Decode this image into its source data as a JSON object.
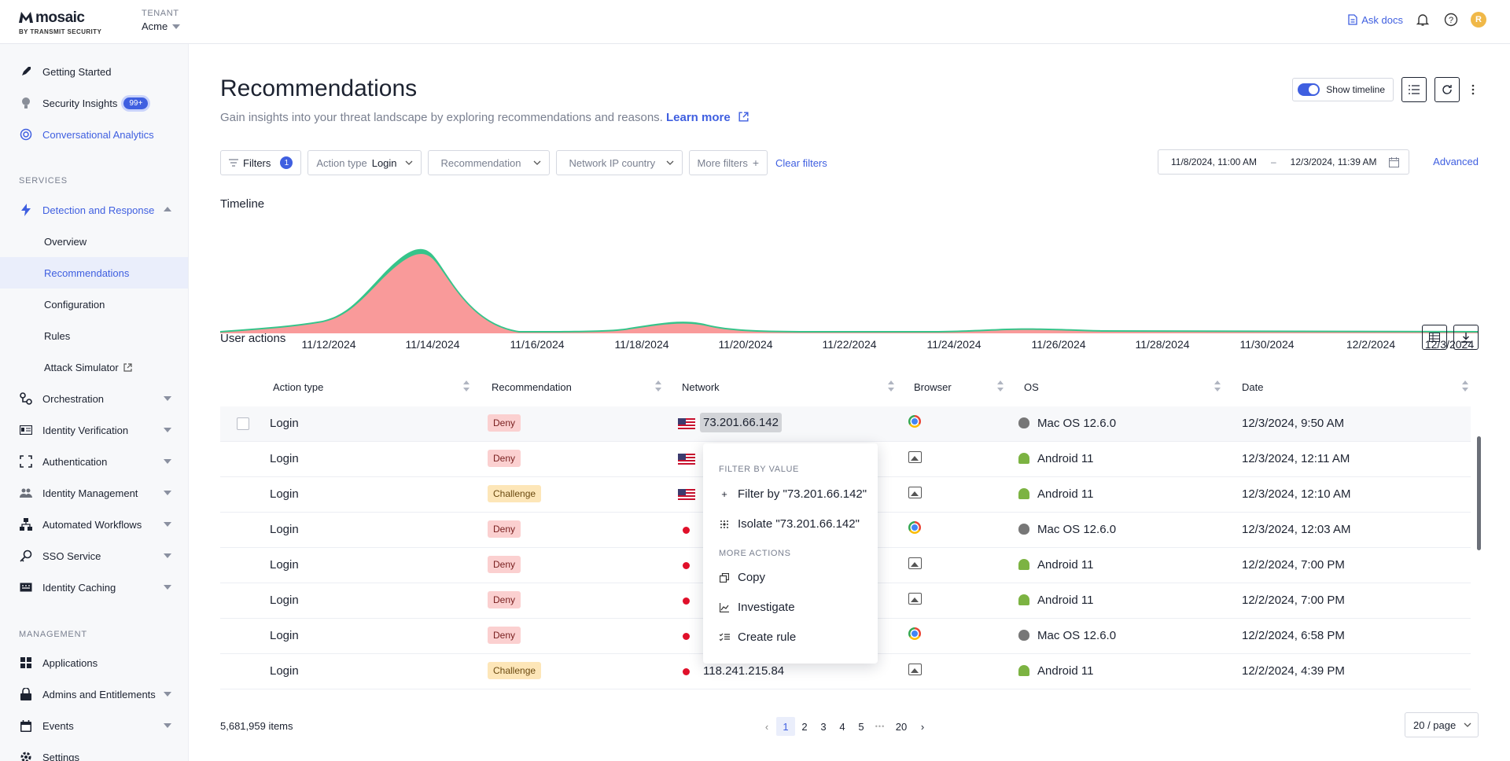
{
  "brand": {
    "name": "mosaic",
    "sub": "BY TRANSMIT SECURITY"
  },
  "tenant": {
    "label": "TENANT",
    "value": "Acme"
  },
  "topbar": {
    "ask_docs": "Ask docs",
    "avatar_initial": "R"
  },
  "sidebar": {
    "top_items": [
      {
        "label": "Getting Started",
        "icon": "rocket-icon"
      },
      {
        "label": "Security Insights",
        "icon": "lightbulb-icon",
        "badge": "99+"
      },
      {
        "label": "Conversational Analytics",
        "icon": "target-icon"
      }
    ],
    "services_label": "SERVICES",
    "detection": {
      "label": "Detection and Response",
      "sub": [
        "Overview",
        "Recommendations",
        "Configuration",
        "Rules",
        "Attack Simulator"
      ]
    },
    "services": [
      "Orchestration",
      "Identity Verification",
      "Authentication",
      "Identity Management",
      "Automated Workflows",
      "SSO Service",
      "Identity Caching"
    ],
    "management_label": "MANAGEMENT",
    "management": [
      "Applications",
      "Admins and Entitlements",
      "Events",
      "Settings"
    ]
  },
  "page": {
    "title": "Recommendations",
    "subtitle": "Gain insights into your threat landscape by exploring recommendations and reasons.",
    "learn_more": "Learn more",
    "show_timeline": "Show timeline"
  },
  "filters": {
    "filters_label": "Filters",
    "filters_count": "1",
    "action_type_label": "Action type",
    "action_type_value": "Login",
    "recommendation": "Recommendation",
    "network_country": "Network IP country",
    "more_filters": "More filters",
    "clear": "Clear filters",
    "date_from": "11/8/2024, 11:00 AM",
    "date_sep": "–",
    "date_to": "12/3/2024, 11:39 AM",
    "advanced": "Advanced"
  },
  "timeline": {
    "label": "Timeline",
    "ticks": [
      "11/12/2024",
      "11/14/2024",
      "11/16/2024",
      "11/18/2024",
      "11/20/2024",
      "11/22/2024",
      "11/24/2024",
      "11/26/2024",
      "11/28/2024",
      "11/30/2024",
      "12/2/2024",
      "12/3/2024"
    ],
    "colors": {
      "deny": "#f99a9a",
      "challenge": "#36c48a"
    }
  },
  "user_actions": {
    "label": "User actions",
    "columns": [
      "Action type",
      "Recommendation",
      "Network",
      "Browser",
      "OS",
      "Date"
    ],
    "rows": [
      {
        "action": "Login",
        "rec": "Deny",
        "flag": "us",
        "ip": "73.201.66.142",
        "browser": "chrome",
        "os": "Mac OS 12.6.0",
        "os_icon": "apple",
        "date": "12/3/2024, 9:50 AM"
      },
      {
        "action": "Login",
        "rec": "Deny",
        "flag": "us",
        "ip": "",
        "browser": "image",
        "os": "Android 11",
        "os_icon": "android",
        "date": "12/3/2024, 12:11 AM"
      },
      {
        "action": "Login",
        "rec": "Challenge",
        "flag": "us",
        "ip": "",
        "browser": "image",
        "os": "Android 11",
        "os_icon": "android",
        "date": "12/3/2024, 12:10 AM"
      },
      {
        "action": "Login",
        "rec": "Deny",
        "flag": "jp",
        "ip": "",
        "browser": "chrome",
        "os": "Mac OS 12.6.0",
        "os_icon": "apple",
        "date": "12/3/2024, 12:03 AM"
      },
      {
        "action": "Login",
        "rec": "Deny",
        "flag": "jp",
        "ip": "",
        "browser": "image",
        "os": "Android 11",
        "os_icon": "android",
        "date": "12/2/2024, 7:00 PM"
      },
      {
        "action": "Login",
        "rec": "Deny",
        "flag": "jp",
        "ip": "",
        "browser": "image",
        "os": "Android 11",
        "os_icon": "android",
        "date": "12/2/2024, 7:00 PM"
      },
      {
        "action": "Login",
        "rec": "Deny",
        "flag": "jp",
        "ip": "",
        "browser": "chrome",
        "os": "Mac OS 12.6.0",
        "os_icon": "apple",
        "date": "12/2/2024, 6:58 PM"
      },
      {
        "action": "Login",
        "rec": "Challenge",
        "flag": "jp",
        "ip": "118.241.215.84",
        "browser": "image",
        "os": "Android 11",
        "os_icon": "android",
        "date": "12/2/2024, 4:39 PM"
      }
    ]
  },
  "context_menu": {
    "section1": "FILTER BY VALUE",
    "filter_by": "Filter by \"73.201.66.142\"",
    "isolate": "Isolate \"73.201.66.142\"",
    "section2": "MORE ACTIONS",
    "copy": "Copy",
    "investigate": "Investigate",
    "create_rule": "Create rule"
  },
  "footer": {
    "items": "5,681,959 items",
    "pages": [
      "1",
      "2",
      "3",
      "4",
      "5"
    ],
    "ellipsis": "•••",
    "last_page": "20",
    "per_page": "20 / page"
  }
}
